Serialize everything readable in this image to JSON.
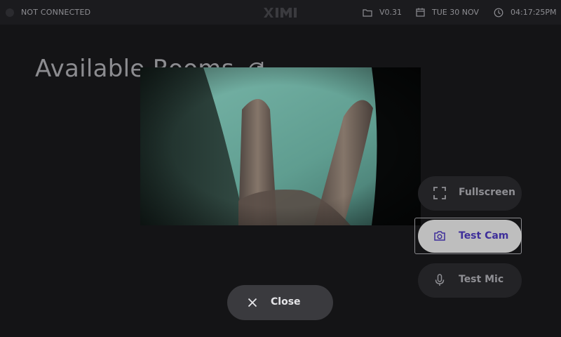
{
  "topbar": {
    "status_text": "NOT CONNECTED",
    "logo_text": "XIMI",
    "version": "V0.31",
    "date": "TUE 30 NOV",
    "time": "04:17:25PM"
  },
  "main": {
    "title": "Available Rooms"
  },
  "controls": {
    "fullscreen_label": "Fullscreen",
    "test_cam_label": "Test Cam",
    "test_mic_label": "Test Mic",
    "close_label": "Close"
  },
  "colors": {
    "background": "#141416",
    "topbar": "#1b1b1e",
    "accent_text": "#3e2f9a",
    "selected_button": "#bebebe"
  },
  "icons": {
    "version": "folder-icon",
    "date": "calendar-icon",
    "time": "clock-icon",
    "fullscreen": "fullscreen-icon",
    "test_cam": "camera-icon",
    "test_mic": "microphone-icon",
    "close": "close-icon",
    "refresh": "refresh-icon"
  }
}
